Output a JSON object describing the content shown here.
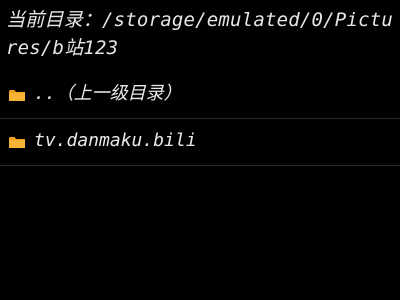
{
  "header": {
    "path_label": "当前目录：",
    "path_value": "/storage/emulated/0/Pictures/b站123"
  },
  "list": {
    "items": [
      {
        "label": "..（上一级目录）",
        "icon": "folder-icon"
      },
      {
        "label": "tv.danmaku.bili",
        "icon": "folder-icon"
      }
    ]
  },
  "colors": {
    "background": "#000000",
    "text": "#e8e8e8",
    "folder": "#f0a020",
    "divider": "#2a2a2a"
  }
}
